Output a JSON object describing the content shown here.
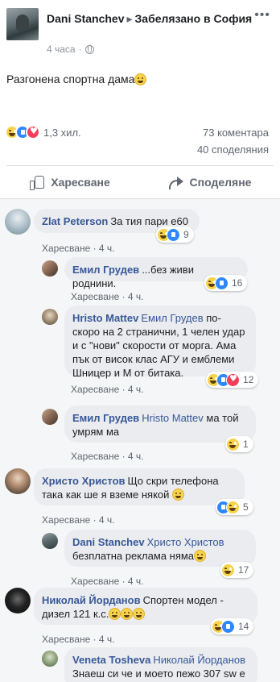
{
  "post": {
    "author": "Dani Stanchev",
    "action": "Забелязано в",
    "location": "София",
    "time": "4 часа",
    "text": "Разгонена спортна дама",
    "more_icon": "more-horizontal-icon"
  },
  "stats": {
    "reactions": "1,3 хил.",
    "comments": "73 коментара",
    "shares": "40 споделяния"
  },
  "actions": {
    "like_label": "Харесване",
    "share_label": "Споделяне"
  },
  "comments": [
    {
      "name": "Zlat Peterson",
      "mention": "",
      "text": "За тия пари е60",
      "like_label": "Харесване",
      "time": "4 ч.",
      "reaction_count": "9"
    },
    {
      "name": "Емил Грудев",
      "mention": "",
      "text": "...без живи роднини.",
      "like_label": "Харесване",
      "time": "4 ч.",
      "reaction_count": "16"
    },
    {
      "name": "Hristo Mattev",
      "mention": "Емил Грудев",
      "text": "по-скоро на 2 странични, 1 челен удар и с \"нови\" скорости от морга. Ама пък от висок клас АГУ и емблеми Шницер и М от битака.",
      "like_label": "Харесване",
      "time": "4 ч.",
      "reaction_count": "12"
    },
    {
      "name": "Емил Грудев",
      "mention": "Hristo Mattev",
      "text": "ма той умрям ма",
      "like_label": "Харесване",
      "time": "4 ч.",
      "reaction_count": "1"
    },
    {
      "name": "Христо Христов",
      "mention": "",
      "text": "Що скри телефона така как ше я вземе някой",
      "like_label": "Харесване",
      "time": "4 ч.",
      "reaction_count": "5"
    },
    {
      "name": "Dani Stanchev",
      "mention": "Христо Христов",
      "text": "безплатна реклама няма",
      "like_label": "Харесване",
      "time": "4 ч.",
      "reaction_count": "17"
    },
    {
      "name": "Николай Йорданов",
      "mention": "",
      "text": "Спортен модел - дизел 121 к.с.",
      "like_label": "Харесване",
      "time": "4 ч.",
      "reaction_count": "14"
    },
    {
      "name": "Veneta Tosheva",
      "mention": "Николай Йорданов",
      "text": "Знаеш си че и моето пежо 307 sw е",
      "like_label": "",
      "time": "",
      "reaction_count": ""
    }
  ]
}
